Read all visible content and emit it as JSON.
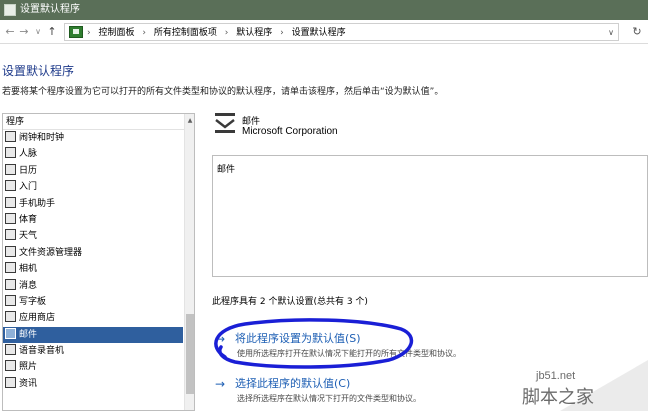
{
  "window": {
    "title": "设置默认程序"
  },
  "navigation": {
    "back_icon": "←",
    "forward_icon": "→",
    "history_icon": "∨",
    "up_icon": "↑",
    "breadcrumb_separator": "›",
    "breadcrumbs": [
      "控制面板",
      "所有控制面板项",
      "默认程序",
      "设置默认程序"
    ],
    "dropdown_icon": "∨",
    "refresh_icon": "↻"
  },
  "page": {
    "title": "设置默认程序",
    "description": "若要将某个程序设置为它可以打开的所有文件类型和协议的默认程序，请单击该程序，然后单击“设为默认值”。"
  },
  "program_list": {
    "header": "程序",
    "items": [
      {
        "label": "闹钟和时钟",
        "icon": "clock-icon"
      },
      {
        "label": "人脉",
        "icon": "people-icon"
      },
      {
        "label": "日历",
        "icon": "calendar-icon"
      },
      {
        "label": "入门",
        "icon": "get-started-icon"
      },
      {
        "label": "手机助手",
        "icon": "phone-icon"
      },
      {
        "label": "体育",
        "icon": "trophy-icon"
      },
      {
        "label": "天气",
        "icon": "weather-icon"
      },
      {
        "label": "文件资源管理器",
        "icon": "folder-icon"
      },
      {
        "label": "相机",
        "icon": "camera-icon"
      },
      {
        "label": "消息",
        "icon": "message-icon"
      },
      {
        "label": "写字板",
        "icon": "wordpad-icon"
      },
      {
        "label": "应用商店",
        "icon": "store-icon"
      },
      {
        "label": "邮件",
        "icon": "mail-icon",
        "selected": true
      },
      {
        "label": "语音录音机",
        "icon": "mic-icon"
      },
      {
        "label": "照片",
        "icon": "photos-icon"
      },
      {
        "label": "资讯",
        "icon": "news-icon"
      }
    ]
  },
  "detail": {
    "name": "邮件",
    "company": "Microsoft Corporation",
    "description": "邮件",
    "defaults_count": "此程序具有 2 个默认设置(总共有 3 个)"
  },
  "actions": [
    {
      "arrow": "→",
      "title": "将此程序设置为默认值(S)",
      "subtitle": "使用所选程序打开在默认情况下能打开的所有文件类型和协议。"
    },
    {
      "arrow": "→",
      "title": "选择此程序的默认值(C)",
      "subtitle": "选择所选程序在默认情况下打开的文件类型和协议。"
    }
  ],
  "watermark": {
    "url": "jb51.net",
    "site_name": "脚本之家"
  },
  "colors": {
    "titlebar": "#5a6f58",
    "link": "#1e5fb4",
    "heading": "#1e3a8a",
    "selection": "#2f5f9e",
    "annotation_circle": "#1a1fd6"
  }
}
